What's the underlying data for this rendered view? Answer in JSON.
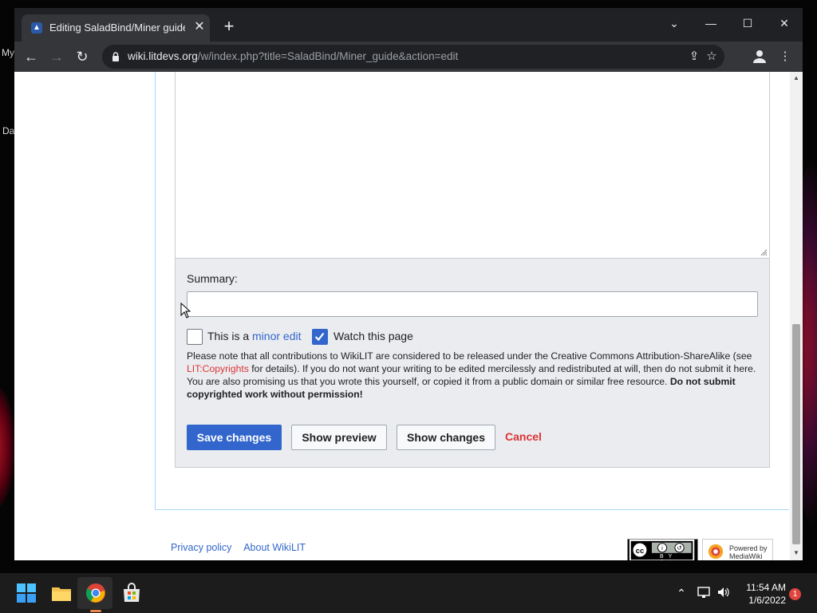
{
  "desktop": {
    "label_1": "My",
    "label_2": "Da"
  },
  "browser": {
    "tab_title": "Editing SaladBind/Miner guide -",
    "tab_close": "✕",
    "new_tab": "+",
    "url_host": "wiki.litdevs.org",
    "url_path": "/w/index.php?title=SaladBind/Miner_guide&action=edit",
    "window_controls": {
      "dropdown": "⌄",
      "minimize": "—",
      "maximize": "☐",
      "close": "✕"
    },
    "nav": {
      "back": "←",
      "forward": "→",
      "reload": "↻"
    }
  },
  "editor": {
    "summary_label": "Summary:",
    "summary_value": "",
    "minor_edit": {
      "prefix": "This is a ",
      "link": "minor edit",
      "checked": false
    },
    "watch_page": {
      "label": "Watch this page",
      "checked": true
    },
    "license_1": "Please note that all contributions to WikiLIT are considered to be released under the Creative Commons Attribution-ShareAlike (see ",
    "license_link": "LIT:Copyrights",
    "license_2": " for details). If you do not want your writing to be edited mercilessly and redistributed at will, then do not submit it here.",
    "license_3": "You are also promising us that you wrote this yourself, or copied it from a public domain or similar free resource. ",
    "license_bold": "Do not submit copyrighted work without permission!",
    "save_button": "Save changes",
    "preview_button": "Show preview",
    "changes_button": "Show changes",
    "cancel_link": "Cancel"
  },
  "footer": {
    "privacy": "Privacy policy",
    "about": "About WikiLIT",
    "cc_badge": "BY SA",
    "mediawiki_1": "Powered by",
    "mediawiki_2": "MediaWiki"
  },
  "taskbar": {
    "time": "11:54 AM",
    "date": "1/6/2022",
    "notifications": "1"
  },
  "colors": {
    "accent": "#3366cc",
    "redlink": "#dd3333",
    "chrome_dark": "#202124"
  }
}
